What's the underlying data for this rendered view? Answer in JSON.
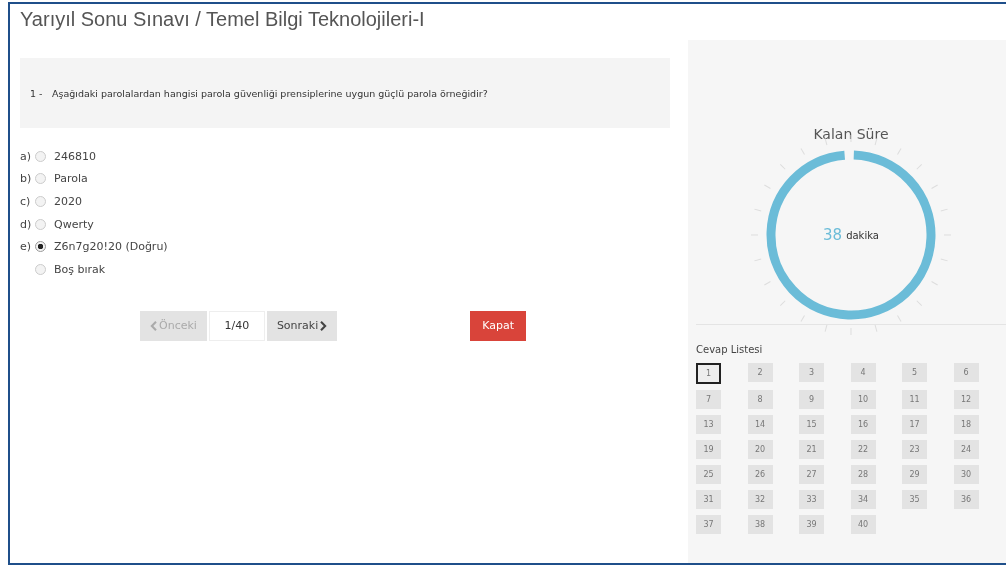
{
  "title": "Yarıyıl Sonu Sınavı / Temel Bilgi Teknolojileri-I",
  "question": {
    "number": "1 -",
    "text": "Aşağıdaki parolalardan hangisi parola güvenliği prensiplerine uygun güçlü parola örneğidir?"
  },
  "options": [
    {
      "label": "a)",
      "text": "246810",
      "selected": false
    },
    {
      "label": "b)",
      "text": "Parola",
      "selected": false
    },
    {
      "label": "c)",
      "text": "2020",
      "selected": false
    },
    {
      "label": "d)",
      "text": "Qwerty",
      "selected": false
    },
    {
      "label": "e)",
      "text": "Z6n7g20!20 (Doğru)",
      "selected": true
    },
    {
      "text": "Boş bırak",
      "selected": false
    }
  ],
  "nav": {
    "previous": {
      "label": "Önceki",
      "disabled": true
    },
    "page": "1/40",
    "next": {
      "label": "Sonraki",
      "disabled": false
    },
    "close": "Kapat"
  },
  "timer": {
    "title": "Kalan Süre",
    "value": "38",
    "unit": "dakika",
    "level": 0.98
  },
  "answer_list": {
    "title": "Cevap Listesi",
    "items": [
      {
        "label": "1",
        "selected": true
      },
      {
        "label": "2",
        "selected": false
      },
      {
        "label": "3",
        "selected": false
      },
      {
        "label": "4",
        "selected": false
      },
      {
        "label": "5",
        "selected": false
      },
      {
        "label": "6",
        "selected": false
      },
      {
        "label": "7",
        "selected": false
      },
      {
        "label": "8",
        "selected": false
      },
      {
        "label": "9",
        "selected": false
      },
      {
        "label": "10",
        "selected": false
      },
      {
        "label": "11",
        "selected": false
      },
      {
        "label": "12",
        "selected": false
      },
      {
        "label": "13",
        "selected": false
      },
      {
        "label": "14",
        "selected": false
      },
      {
        "label": "15",
        "selected": false
      },
      {
        "label": "16",
        "selected": false
      },
      {
        "label": "17",
        "selected": false
      },
      {
        "label": "18",
        "selected": false
      },
      {
        "label": "19",
        "selected": false
      },
      {
        "label": "20",
        "selected": false
      },
      {
        "label": "21",
        "selected": false
      },
      {
        "label": "22",
        "selected": false
      },
      {
        "label": "23",
        "selected": false
      },
      {
        "label": "24",
        "selected": false
      },
      {
        "label": "25",
        "selected": false
      },
      {
        "label": "26",
        "selected": false
      },
      {
        "label": "27",
        "selected": false
      },
      {
        "label": "28",
        "selected": false
      },
      {
        "label": "29",
        "selected": false
      },
      {
        "label": "30",
        "selected": false
      },
      {
        "label": "31",
        "selected": false
      },
      {
        "label": "32",
        "selected": false
      },
      {
        "label": "33",
        "selected": false
      },
      {
        "label": "34",
        "selected": false
      },
      {
        "label": "35",
        "selected": false
      },
      {
        "label": "36",
        "selected": false
      },
      {
        "label": "37",
        "selected": false
      },
      {
        "label": "38",
        "selected": false
      },
      {
        "label": "39",
        "selected": false
      },
      {
        "label": "40",
        "selected": false
      }
    ]
  }
}
